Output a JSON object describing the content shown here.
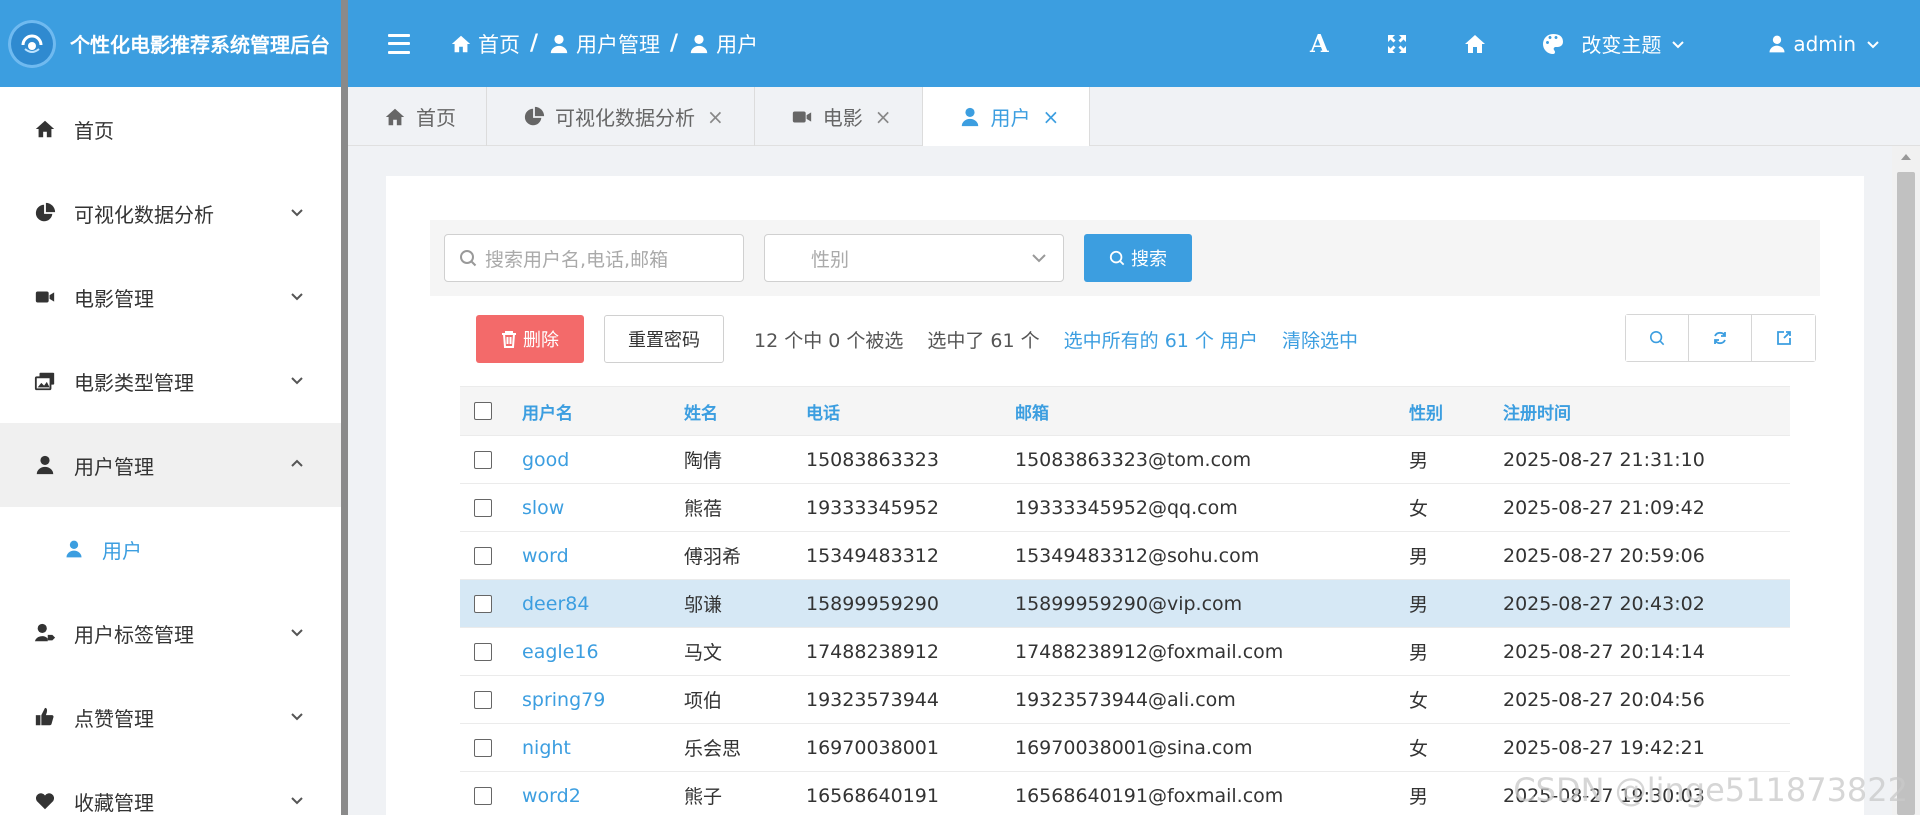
{
  "brand": {
    "title": "个性化电影推荐系统管理后台"
  },
  "sidebar": {
    "items": [
      {
        "label": "首页",
        "icon": "home-icon",
        "has_children": false
      },
      {
        "label": "可视化数据分析",
        "icon": "pie-chart-icon",
        "has_children": true,
        "expanded": false
      },
      {
        "label": "电影管理",
        "icon": "video-camera-icon",
        "has_children": true,
        "expanded": false
      },
      {
        "label": "电影类型管理",
        "icon": "images-icon",
        "has_children": true,
        "expanded": false
      },
      {
        "label": "用户管理",
        "icon": "user-icon",
        "has_children": true,
        "expanded": true,
        "children": [
          {
            "label": "用户",
            "icon": "user-icon",
            "active": true
          }
        ]
      },
      {
        "label": "用户标签管理",
        "icon": "user-tag-icon",
        "has_children": true,
        "expanded": false
      },
      {
        "label": "点赞管理",
        "icon": "thumbs-up-icon",
        "has_children": true,
        "expanded": false
      },
      {
        "label": "收藏管理",
        "icon": "heart-icon",
        "has_children": true,
        "expanded": false
      }
    ]
  },
  "header": {
    "breadcrumb": [
      {
        "label": "首页",
        "icon": "home-icon"
      },
      {
        "label": "用户管理",
        "icon": "user-icon"
      },
      {
        "label": "用户",
        "icon": "user-icon"
      }
    ],
    "breadcrumb_sep": "/",
    "font_icon_glyph": "A",
    "theme_label": "改变主题",
    "user_label": "admin"
  },
  "tabs": [
    {
      "label": "首页",
      "icon": "home-icon",
      "closable": false,
      "active": false
    },
    {
      "label": "可视化数据分析",
      "icon": "pie-chart-icon",
      "closable": true,
      "active": false
    },
    {
      "label": "电影",
      "icon": "video-camera-icon",
      "closable": true,
      "active": false
    },
    {
      "label": "用户",
      "icon": "user-icon",
      "closable": true,
      "active": true
    }
  ],
  "tab_close_glyph": "×",
  "filters": {
    "search_placeholder": "搜索用户名,电话,邮箱",
    "gender_placeholder": "性别",
    "search_button": "搜索"
  },
  "toolbar": {
    "delete_button": "删除",
    "reset_password_button": "重置密码",
    "selection_info": "12 个中 0 个被选",
    "selected_count": "选中了 61 个",
    "select_all_link": "选中所有的 61 个 用户",
    "clear_selection_link": "清除选中"
  },
  "table": {
    "columns": [
      "用户名",
      "姓名",
      "电话",
      "邮箱",
      "性别",
      "注册时间"
    ],
    "rows": [
      {
        "username": "good",
        "name": "陶倩",
        "phone": "15083863323",
        "email": "15083863323@tom.com",
        "gender": "男",
        "registered": "2025-08-27 21:31:10",
        "highlighted": false
      },
      {
        "username": "slow",
        "name": "熊蓓",
        "phone": "19333345952",
        "email": "19333345952@qq.com",
        "gender": "女",
        "registered": "2025-08-27 21:09:42",
        "highlighted": false
      },
      {
        "username": "word",
        "name": "傅羽希",
        "phone": "15349483312",
        "email": "15349483312@sohu.com",
        "gender": "男",
        "registered": "2025-08-27 20:59:06",
        "highlighted": false
      },
      {
        "username": "deer84",
        "name": "邬谦",
        "phone": "15899959290",
        "email": "15899959290@vip.com",
        "gender": "男",
        "registered": "2025-08-27 20:43:02",
        "highlighted": true
      },
      {
        "username": "eagle16",
        "name": "马文",
        "phone": "17488238912",
        "email": "17488238912@foxmail.com",
        "gender": "男",
        "registered": "2025-08-27 20:14:14",
        "highlighted": false
      },
      {
        "username": "spring79",
        "name": "项伯",
        "phone": "19323573944",
        "email": "19323573944@ali.com",
        "gender": "女",
        "registered": "2025-08-27 20:04:56",
        "highlighted": false
      },
      {
        "username": "night",
        "name": "乐会思",
        "phone": "16970038001",
        "email": "16970038001@sina.com",
        "gender": "女",
        "registered": "2025-08-27 19:42:21",
        "highlighted": false
      },
      {
        "username": "word2",
        "name": "熊子",
        "phone": "16568640191",
        "email": "16568640191@foxmail.com",
        "gender": "男",
        "registered": "2025-08-27 19:30:03",
        "highlighted": false
      }
    ]
  },
  "watermark": "CSDN @linge511873822",
  "colors": {
    "primary": "#3c9ee0",
    "danger": "#f36a6a",
    "row_highlight": "#d6e8f5"
  }
}
